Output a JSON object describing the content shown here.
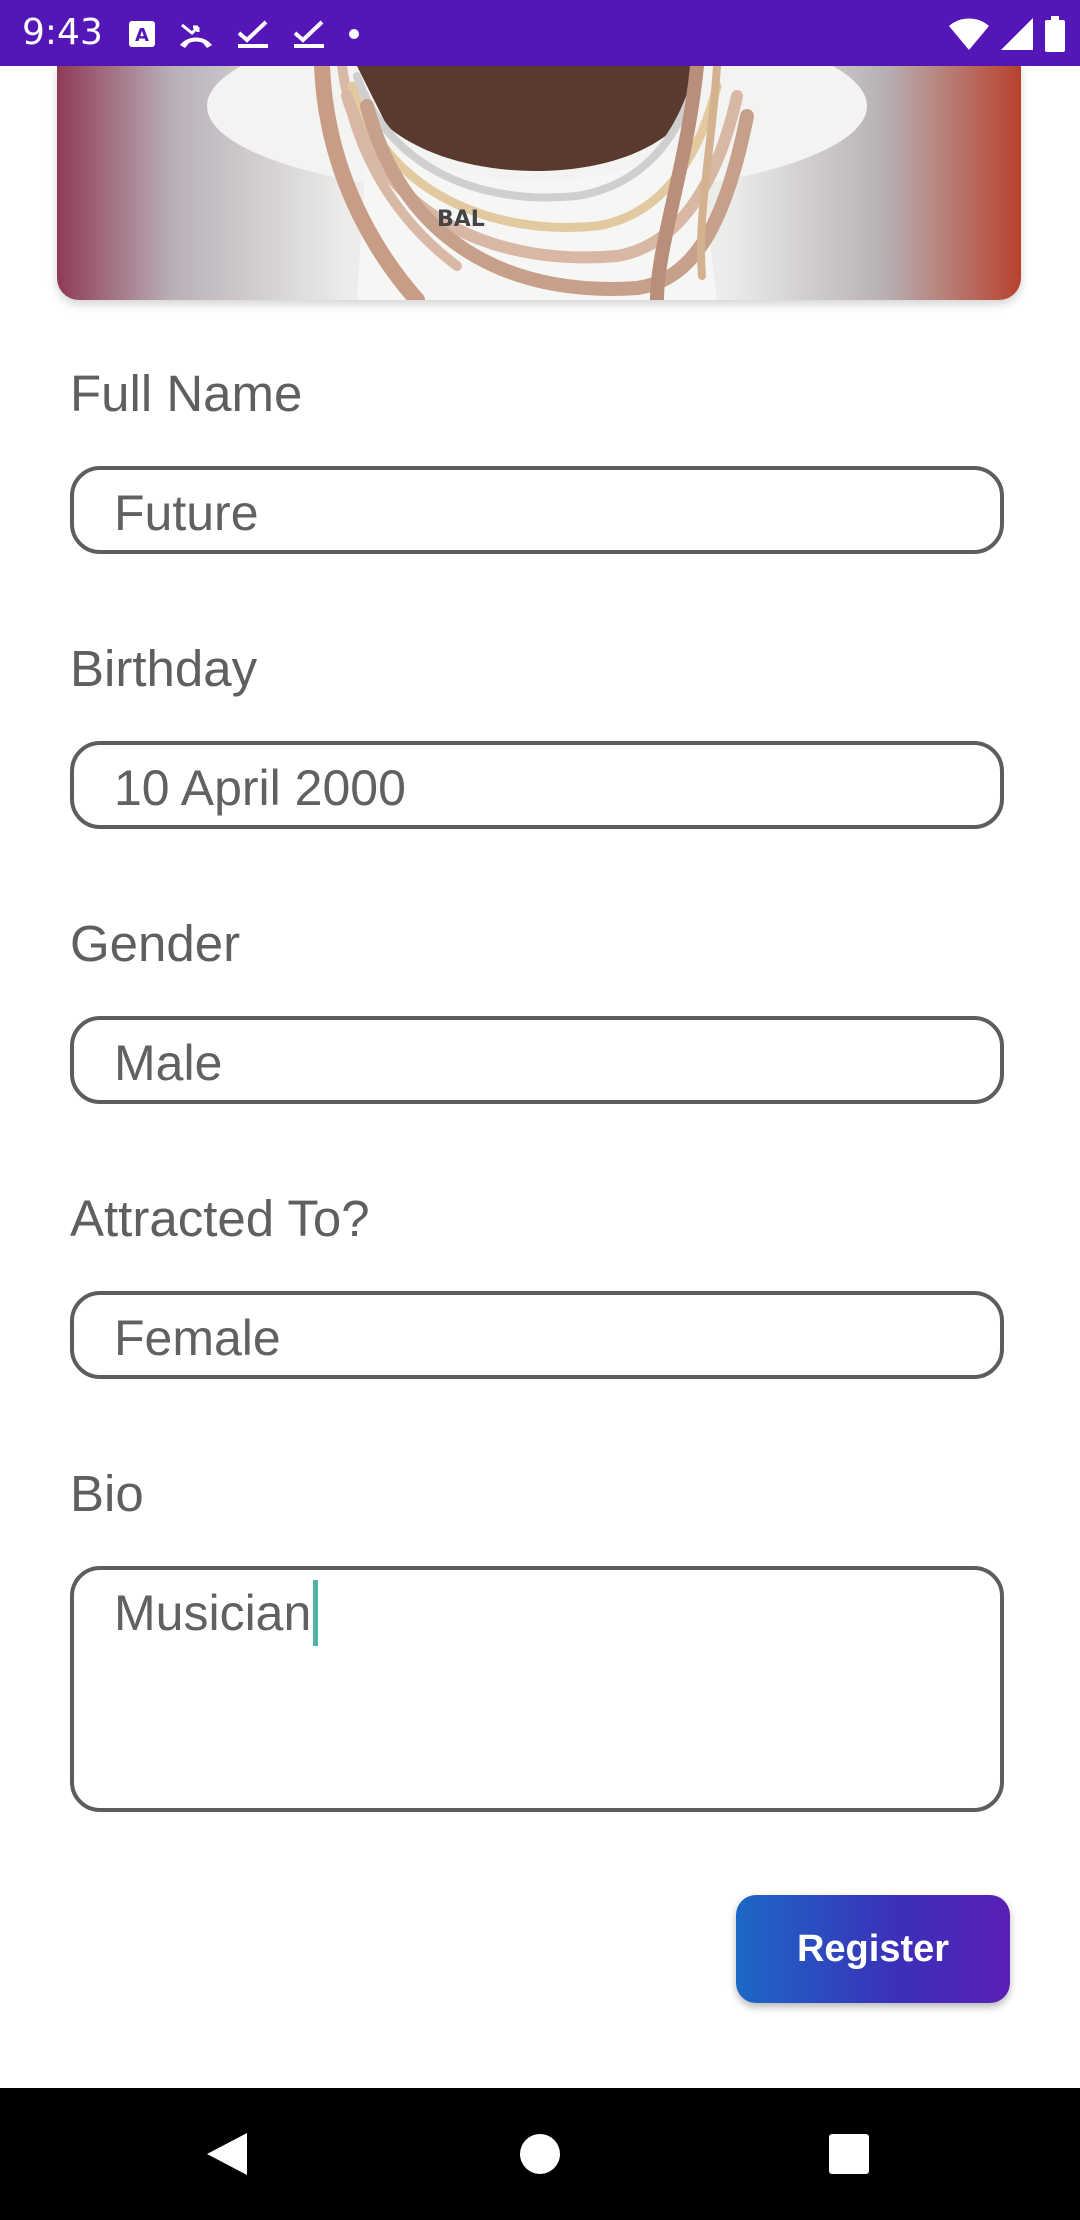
{
  "status_bar": {
    "time": "9:43",
    "left_icons": [
      "keyboard-a-icon",
      "missed-call-icon",
      "check-icon",
      "check-icon",
      "dot-icon"
    ],
    "right_icons": [
      "wifi-icon",
      "signal-icon",
      "battery-icon"
    ],
    "background": "#5516b8"
  },
  "form": {
    "full_name": {
      "label": "Full Name",
      "value": "Future"
    },
    "birthday": {
      "label": "Birthday",
      "value": "10 April 2000"
    },
    "gender": {
      "label": "Gender",
      "value": "Male"
    },
    "attracted_to": {
      "label": "Attracted To?",
      "value": "Female"
    },
    "bio": {
      "label": "Bio",
      "value": "Musician"
    }
  },
  "register_button": {
    "label": "Register",
    "gradient_start": "#1c68c6",
    "gradient_end": "#5a1fb5"
  },
  "nav_bar": {
    "icons": [
      "back-icon",
      "home-icon",
      "recents-icon"
    ]
  }
}
